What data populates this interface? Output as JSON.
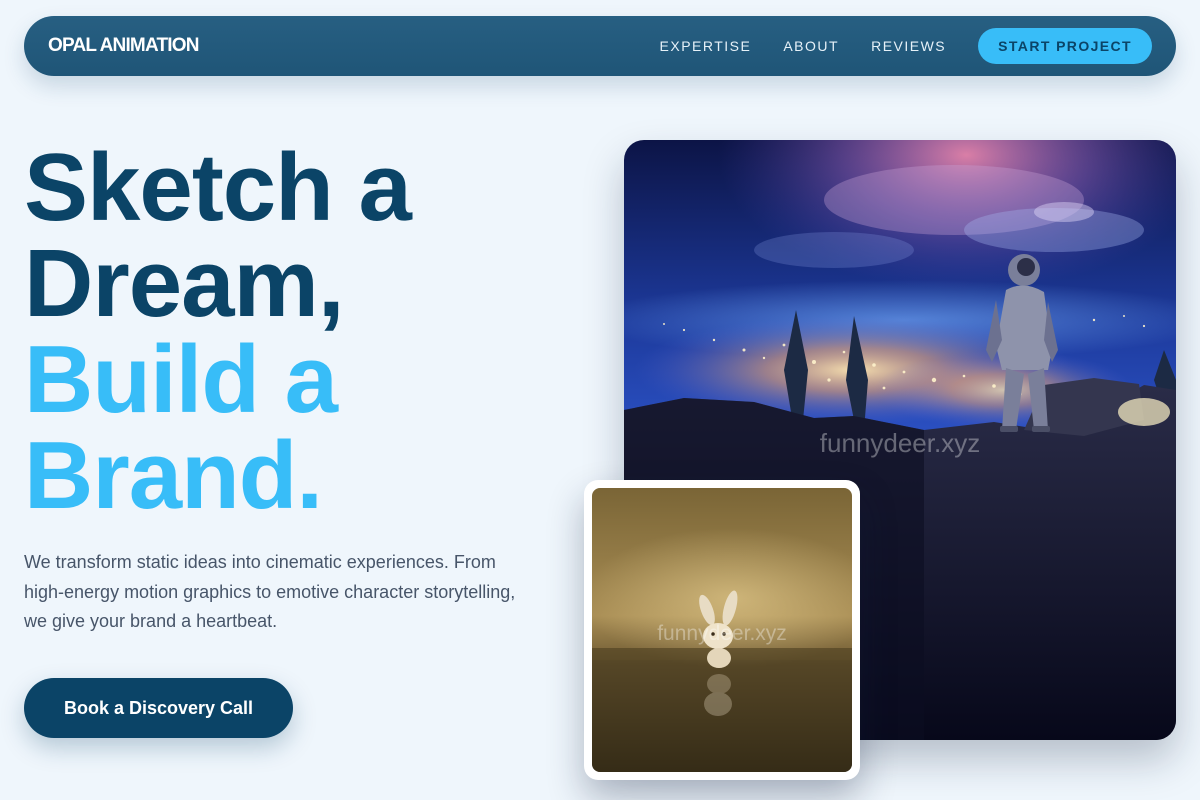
{
  "brand": {
    "name": "OPAL ANIMATION"
  },
  "nav": {
    "links": [
      "EXPERTISE",
      "ABOUT",
      "REVIEWS"
    ],
    "cta_label": "START PROJECT"
  },
  "hero": {
    "title_lines": [
      "Sketch a",
      "Dream,",
      "Build a",
      "Brand."
    ],
    "description": "We transform static ideas into cinematic experiences. From high-energy motion graphics to emotive character storytelling, we give your brand a heartbeat.",
    "button_label": "Book a Discovery Call"
  },
  "images": {
    "main": {
      "subject": "astronaut on cliff overlooking night city",
      "watermark": "funnydeer.xyz"
    },
    "secondary": {
      "subject": "toy bunny on reflective floor",
      "watermark": "funnydeer.xyz"
    }
  },
  "colors": {
    "nav_bg": "#235a7d",
    "accent": "#38bdf8",
    "dark": "#0b4467",
    "page_bg": "#eff6fc",
    "body_text": "#475569"
  }
}
